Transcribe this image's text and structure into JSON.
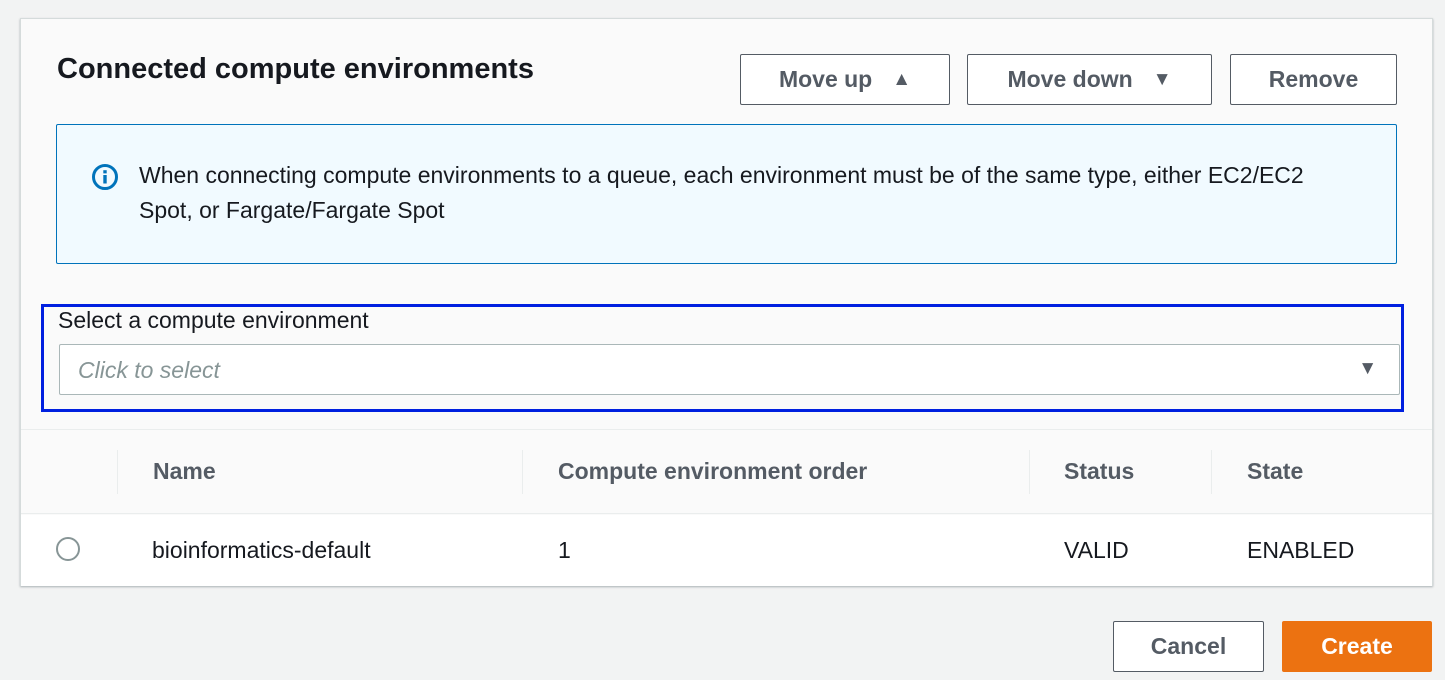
{
  "panel": {
    "title": "Connected compute environments",
    "actions": {
      "move_up_label": "Move up",
      "move_down_label": "Move down",
      "remove_label": "Remove"
    }
  },
  "alert": {
    "icon": "info-icon",
    "text": "When connecting compute environments to a queue, each environment must be of the same type, either EC2/EC2 Spot, or Fargate/Fargate Spot"
  },
  "select": {
    "label": "Select a compute environment",
    "placeholder": "Click to select"
  },
  "table": {
    "columns": [
      "Name",
      "Compute environment order",
      "Status",
      "State"
    ],
    "rows": [
      {
        "name": "bioinformatics-default",
        "order": "1",
        "status": "VALID",
        "state": "ENABLED",
        "selected": false
      }
    ]
  },
  "footer": {
    "cancel_label": "Cancel",
    "create_label": "Create"
  },
  "colors": {
    "primary": "#ec7211",
    "info_border": "#0073bb",
    "info_background": "#f1faff",
    "focus_outline": "#0020e0"
  }
}
